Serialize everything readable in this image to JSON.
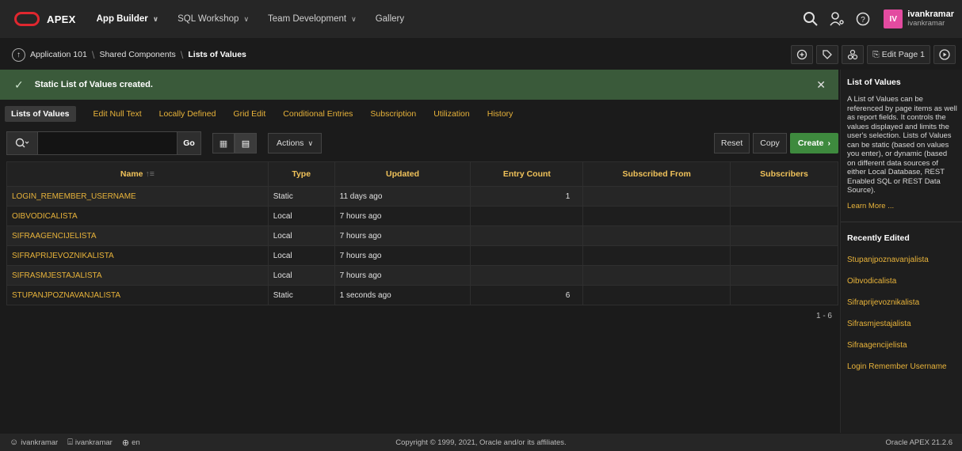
{
  "header": {
    "logo_text": "APEX",
    "nav": [
      {
        "label": "App Builder",
        "has_menu": true,
        "active": true
      },
      {
        "label": "SQL Workshop",
        "has_menu": true,
        "active": false
      },
      {
        "label": "Team Development",
        "has_menu": true,
        "active": false
      },
      {
        "label": "Gallery",
        "has_menu": false,
        "active": false
      }
    ],
    "icons": [
      "search-icon",
      "user-settings-icon",
      "help-icon"
    ],
    "user": {
      "initials": "IV",
      "name": "ivankramar",
      "workspace": "ivankramar"
    }
  },
  "breadcrumb": {
    "items": [
      "Application 101",
      "Shared Components",
      "Lists of Values"
    ],
    "tools": {
      "edit_page_label": "Edit Page 1"
    }
  },
  "banner": {
    "message": "Static List of Values created."
  },
  "subtabs": [
    "Lists of Values",
    "Edit Null Text",
    "Locally Defined",
    "Grid Edit",
    "Conditional Entries",
    "Subscription",
    "Utilization",
    "History"
  ],
  "toolbar": {
    "search_value": "",
    "go_label": "Go",
    "actions_label": "Actions",
    "reset_label": "Reset",
    "copy_label": "Copy",
    "create_label": "Create"
  },
  "table": {
    "columns": [
      "Name",
      "Type",
      "Updated",
      "Entry Count",
      "Subscribed From",
      "Subscribers"
    ],
    "rows": [
      {
        "name": "LOGIN_REMEMBER_USERNAME",
        "type": "Static",
        "updated": "11 days ago",
        "entry_count": "1",
        "subscribed_from": "",
        "subscribers": ""
      },
      {
        "name": "OIBVODICALISTA",
        "type": "Local",
        "updated": "7 hours ago",
        "entry_count": "",
        "subscribed_from": "",
        "subscribers": ""
      },
      {
        "name": "SIFRAAGENCIJELISTA",
        "type": "Local",
        "updated": "7 hours ago",
        "entry_count": "",
        "subscribed_from": "",
        "subscribers": ""
      },
      {
        "name": "SIFRAPRIJEVOZNIKALISTA",
        "type": "Local",
        "updated": "7 hours ago",
        "entry_count": "",
        "subscribed_from": "",
        "subscribers": ""
      },
      {
        "name": "SIFRASMJESTAJALISTA",
        "type": "Local",
        "updated": "7 hours ago",
        "entry_count": "",
        "subscribed_from": "",
        "subscribers": ""
      },
      {
        "name": "STUPANJPOZNAVANJALISTA",
        "type": "Static",
        "updated": "1 seconds ago",
        "entry_count": "6",
        "subscribed_from": "",
        "subscribers": ""
      }
    ],
    "pagination": "1 - 6"
  },
  "sidebar": {
    "title": "List of Values",
    "description": "A List of Values can be referenced by page items as well as report fields. It controls the values displayed and limits the user's selection. Lists of Values can be static (based on values you enter), or dynamic (based on different data sources of either Local Database, REST Enabled SQL or REST Data Source).",
    "learn_more": "Learn More ...",
    "recent_title": "Recently Edited",
    "recent": [
      "Stupanjpoznavanjalista",
      "Oibvodicalista",
      "Sifraprijevoznikalista",
      "Sifrasmjestajalista",
      "Sifraagencijelista",
      "Login Remember Username"
    ]
  },
  "footer": {
    "user": "ivankramar",
    "schema": "ivankramar",
    "language": "en",
    "copyright": "Copyright © 1999, 2021, Oracle and/or its affiliates.",
    "version": "Oracle APEX 21.2.6"
  },
  "colors": {
    "accent_link": "#e8b33a",
    "banner_bg": "#3a5a3a",
    "create_button": "#3e8a3e",
    "avatar_bg": "#e34ba0",
    "logo_red": "#e0272f"
  }
}
